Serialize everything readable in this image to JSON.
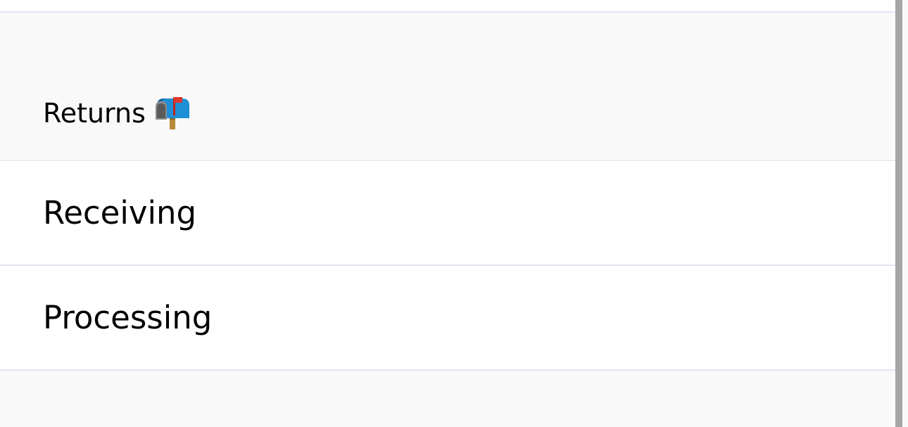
{
  "list": {
    "section_header": {
      "title": "Returns",
      "icon": "mailbox-icon"
    },
    "items": [
      {
        "label": "Receiving"
      },
      {
        "label": "Processing"
      }
    ]
  },
  "colors": {
    "background": "#f9f9f9",
    "row_background": "#ffffff",
    "separator": "#e3e3f6",
    "scrollbar": "#a6a6a6"
  }
}
